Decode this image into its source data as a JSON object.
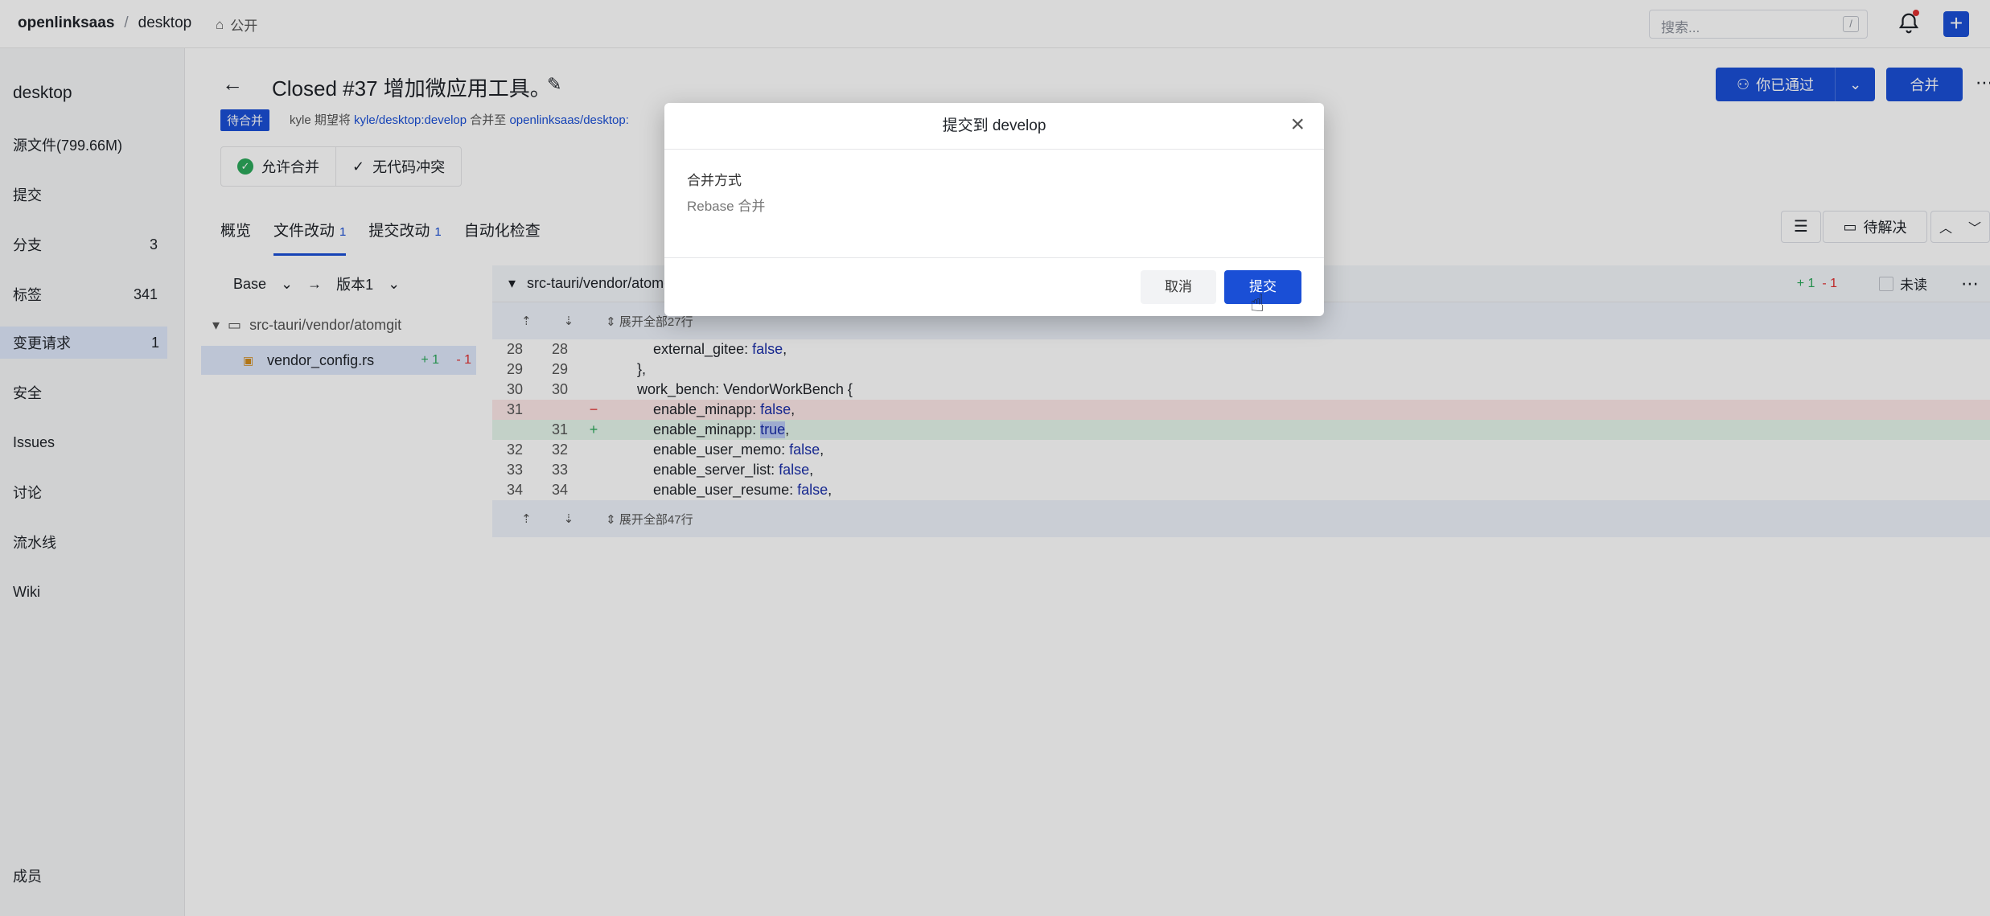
{
  "topbar": {
    "org": "openlinksaas",
    "sep": "/",
    "repo": "desktop",
    "visibility": "公开",
    "search_placeholder": "搜索...",
    "search_shortcut": "/"
  },
  "sidebar": {
    "title": "desktop",
    "items": [
      {
        "label": "源文件(799.66M)",
        "count": ""
      },
      {
        "label": "提交",
        "count": ""
      },
      {
        "label": "分支",
        "count": "3"
      },
      {
        "label": "标签",
        "count": "341"
      },
      {
        "label": "变更请求",
        "count": "1"
      },
      {
        "label": "安全",
        "count": ""
      },
      {
        "label": "Issues",
        "count": ""
      },
      {
        "label": "讨论",
        "count": ""
      },
      {
        "label": "流水线",
        "count": ""
      },
      {
        "label": "Wiki",
        "count": ""
      }
    ],
    "members": "成员"
  },
  "pr": {
    "title": "Closed #37 增加微应用工具。",
    "badge": "待合并",
    "meta_prefix": "kyle 期望将",
    "source": "kyle/desktop:develop",
    "meta_mid": "合并至",
    "target": "openlinksaas/desktop:"
  },
  "actions": {
    "approved": "你已通过",
    "merge": "合并"
  },
  "checks": {
    "allow_merge": "允许合并",
    "no_conflict": "无代码冲突"
  },
  "tabs": [
    {
      "label": "概览",
      "num": ""
    },
    {
      "label": "文件改动",
      "num": "1"
    },
    {
      "label": "提交改动",
      "num": "1"
    },
    {
      "label": "自动化检查",
      "num": ""
    }
  ],
  "toolbar": {
    "unresolved": "待解决"
  },
  "filepanel": {
    "base": "Base",
    "arrow": "→",
    "version": "版本1",
    "folder": "src-tauri/vendor/atomgit",
    "file": "vendor_config.rs",
    "file_plus": "+ 1",
    "file_minus": "- 1"
  },
  "diff": {
    "path": "src-tauri/vendor/atomgit/vendor_config.rs",
    "plus": "+ 1",
    "minus": "- 1",
    "unread": "未读",
    "expand_top": "展开全部27行",
    "expand_bottom": "展开全部47行",
    "rows": [
      {
        "l": "28",
        "r": "28",
        "s": "",
        "t": "            external_gitee: ",
        "k": "false",
        "e": ",",
        "kind": "ctx"
      },
      {
        "l": "29",
        "r": "29",
        "s": "",
        "t": "        },",
        "k": "",
        "e": "",
        "kind": "ctx"
      },
      {
        "l": "30",
        "r": "30",
        "s": "",
        "t": "        work_bench: VendorWorkBench {",
        "k": "",
        "e": "",
        "kind": "ctx"
      },
      {
        "l": "31",
        "r": "",
        "s": "−",
        "t": "            enable_minapp: ",
        "k": "false",
        "e": ",",
        "kind": "del"
      },
      {
        "l": "",
        "r": "31",
        "s": "+",
        "t": "            enable_minapp: ",
        "k": "true",
        "e": ",",
        "kind": "add"
      },
      {
        "l": "32",
        "r": "32",
        "s": "",
        "t": "            enable_user_memo: ",
        "k": "false",
        "e": ",",
        "kind": "ctx"
      },
      {
        "l": "33",
        "r": "33",
        "s": "",
        "t": "            enable_server_list: ",
        "k": "false",
        "e": ",",
        "kind": "ctx"
      },
      {
        "l": "34",
        "r": "34",
        "s": "",
        "t": "            enable_user_resume: ",
        "k": "false",
        "e": ",",
        "kind": "ctx"
      }
    ]
  },
  "modal": {
    "title": "提交到 develop",
    "label": "合并方式",
    "value": "Rebase 合并",
    "cancel": "取消",
    "submit": "提交"
  }
}
